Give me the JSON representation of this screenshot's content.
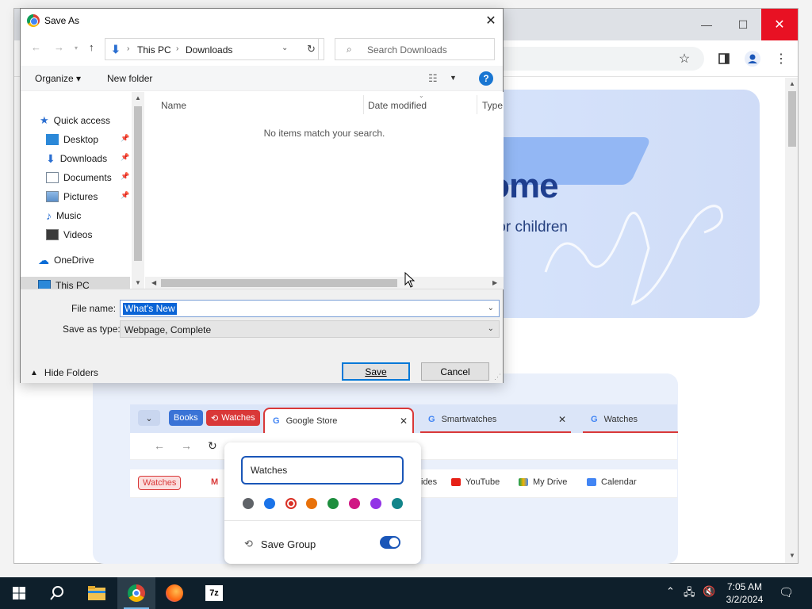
{
  "chrome": {
    "hero_title": "rome",
    "hero_subtitle": "for children",
    "minimize": "—",
    "maximize": "☐",
    "close": "✕"
  },
  "illustration": {
    "chip_books": "Books",
    "chip_watches": "Watches",
    "tab_active": "Google Store",
    "tab_2": "Smartwatches",
    "tab_3": "Watches",
    "tab_close": "✕",
    "bookmark_chip": "Watches",
    "bookmarks": [
      "ides",
      "YouTube",
      "My Drive",
      "Calendar"
    ],
    "group_name_input": "Watches",
    "colors": [
      "#5f6368",
      "#1a73e8",
      "#d93025",
      "#e8710a",
      "#1e8e3e",
      "#d01884",
      "#9334e6",
      "#12858a"
    ],
    "save_group_label": "Save Group"
  },
  "dialog": {
    "title": "Save As",
    "close": "✕",
    "address": {
      "segments": [
        "This PC",
        "Downloads"
      ]
    },
    "search_placeholder": "Search Downloads",
    "toolbar": {
      "organize": "Organize ▾",
      "new_folder": "New folder"
    },
    "nav": {
      "quick_access": "Quick access",
      "items": [
        {
          "label": "Desktop",
          "pinned": true
        },
        {
          "label": "Downloads",
          "pinned": true
        },
        {
          "label": "Documents",
          "pinned": true
        },
        {
          "label": "Pictures",
          "pinned": true
        },
        {
          "label": "Music",
          "pinned": false
        },
        {
          "label": "Videos",
          "pinned": false
        }
      ],
      "onedrive": "OneDrive",
      "this_pc": "This PC"
    },
    "columns": [
      "Name",
      "Date modified",
      "Type"
    ],
    "empty_message": "No items match your search.",
    "file_name_label": "File name:",
    "file_name_value": "What's New",
    "save_type_label": "Save as type:",
    "save_type_value": "Webpage, Complete",
    "hide_folders": "Hide Folders",
    "save_button": "Save",
    "cancel_button": "Cancel"
  },
  "taskbar": {
    "time": "7:05 AM",
    "date": "3/2/2024",
    "apps": [
      "start",
      "search",
      "file-explorer",
      "chrome",
      "firefox",
      "7-zip"
    ]
  }
}
